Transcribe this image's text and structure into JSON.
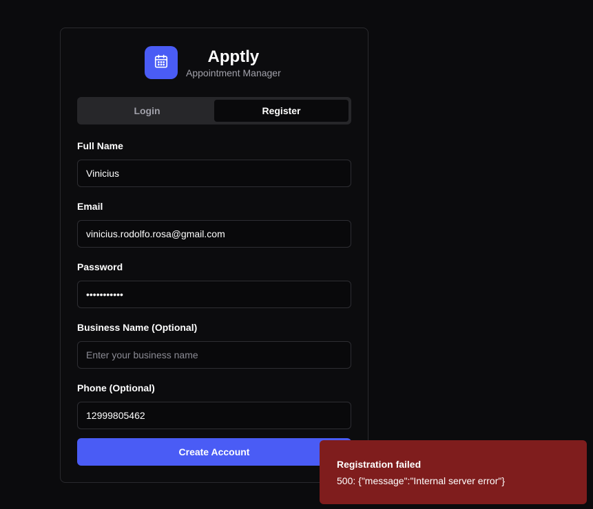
{
  "brand": {
    "title": "Apptly",
    "subtitle": "Appointment Manager",
    "icon": "calendar-icon",
    "accent_color": "#4a5cf5"
  },
  "tabs": [
    {
      "label": "Login",
      "active": false
    },
    {
      "label": "Register",
      "active": true
    }
  ],
  "form": {
    "full_name": {
      "label": "Full Name",
      "value": "Vinicius"
    },
    "email": {
      "label": "Email",
      "value": "vinicius.rodolfo.rosa@gmail.com"
    },
    "password": {
      "label": "Password",
      "value": "•••••••••••"
    },
    "business_name": {
      "label": "Business Name (Optional)",
      "value": "",
      "placeholder": "Enter your business name"
    },
    "phone": {
      "label": "Phone (Optional)",
      "value": "12999805462"
    },
    "submit_label": "Create Account"
  },
  "toast": {
    "title": "Registration failed",
    "message": "500: {\"message\":\"Internal server error\"}",
    "color": "#7f1d1d"
  }
}
